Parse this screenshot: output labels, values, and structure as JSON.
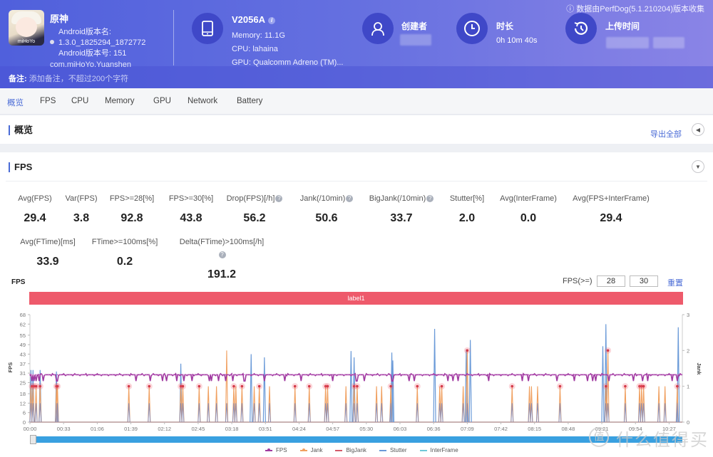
{
  "header": {
    "app": {
      "name": "原神",
      "icon_label": "miHoYo",
      "version_name_label": "Android版本名:",
      "version_name": "1.3.0_1825294_1872772",
      "version_code_line": "Android版本号: 151",
      "package": "com.miHoYo.Yuanshen"
    },
    "device": {
      "icon": "phone-icon",
      "model": "V2056A",
      "memory": "Memory: 11.1G",
      "cpu": "CPU: lahaina",
      "gpu": "GPU: Qualcomm Adreno (TM)..."
    },
    "creator": {
      "icon": "user-icon",
      "title": "创建者"
    },
    "duration": {
      "icon": "clock-icon",
      "title": "时长",
      "value": "0h 10m 40s"
    },
    "upload": {
      "icon": "history-icon",
      "title": "上传时间"
    },
    "perfdog_note": "数据由PerfDog(5.1.210204)版本收集",
    "remark_label": "备注:",
    "remark_placeholder": "添加备注，不超过200个字符"
  },
  "tabs": [
    {
      "label": "概览",
      "active": true
    },
    {
      "label": "FPS"
    },
    {
      "label": "CPU"
    },
    {
      "label": "Memory"
    },
    {
      "label": "GPU"
    },
    {
      "label": "Network"
    },
    {
      "label": "Battery"
    }
  ],
  "overview": {
    "title": "概览",
    "export_label": "导出全部"
  },
  "fps_section": {
    "title": "FPS",
    "metrics_row1": [
      {
        "label": "Avg(FPS)",
        "value": "29.4"
      },
      {
        "label": "Var(FPS)",
        "value": "3.8"
      },
      {
        "label": "FPS>=28[%]",
        "value": "92.8"
      },
      {
        "label": "FPS>=30[%]",
        "value": "43.8"
      },
      {
        "label": "Drop(FPS)[/h]",
        "value": "56.2",
        "help": true
      },
      {
        "label": "Jank(/10min)",
        "value": "50.6",
        "help": true
      },
      {
        "label": "BigJank(/10min)",
        "value": "33.7",
        "help": true
      },
      {
        "label": "Stutter[%]",
        "value": "2.0"
      },
      {
        "label": "Avg(InterFrame)",
        "value": "0.0"
      },
      {
        "label": "Avg(FPS+InterFrame)",
        "value": "29.4"
      }
    ],
    "metrics_row2": [
      {
        "label": "Avg(FTime)[ms]",
        "value": "33.9"
      },
      {
        "label": "FTime>=100ms[%]",
        "value": "0.2"
      },
      {
        "label": "Delta(FTime)>100ms[/h]",
        "value": "191.2",
        "help": true
      }
    ],
    "chart_title": "FPS",
    "threshold_label": "FPS(>=)",
    "threshold_low": "28",
    "threshold_high": "30",
    "reset_label": "重置",
    "label_bar": "label1"
  },
  "chart_data": {
    "type": "line",
    "title": "FPS",
    "xlabel": "",
    "ylabel": "FPS",
    "y2label": "Jank",
    "ylim": [
      0,
      68
    ],
    "y2lim": [
      0,
      3
    ],
    "yticks": [
      0,
      6,
      12,
      18,
      25,
      31,
      37,
      43,
      49,
      55,
      62,
      68
    ],
    "y2ticks": [
      0,
      1,
      2,
      3
    ],
    "x_ticks": [
      "00:00",
      "00:33",
      "01:06",
      "01:39",
      "02:12",
      "02:45",
      "03:18",
      "03:51",
      "04:24",
      "04:57",
      "05:30",
      "06:03",
      "06:36",
      "07:09",
      "07:42",
      "08:15",
      "08:48",
      "09:21",
      "09:54",
      "10:27"
    ],
    "duration_s": 640,
    "fps_baseline": 30,
    "legend": [
      {
        "name": "FPS",
        "color": "#a03aa0",
        "marker": true
      },
      {
        "name": "Jank",
        "color": "#f0a060",
        "marker": true
      },
      {
        "name": "BigJank",
        "color": "#d45a6a",
        "marker": false
      },
      {
        "name": "Stutter",
        "color": "#6a9ad8",
        "marker": false
      },
      {
        "name": "InterFrame",
        "color": "#70c8d8",
        "marker": false
      }
    ],
    "fps_dips_s": [
      2,
      4,
      6,
      9,
      13,
      26,
      27,
      104,
      118,
      130,
      134,
      144,
      151,
      159,
      176,
      178,
      185,
      192,
      199,
      210,
      211,
      230,
      250,
      250,
      266,
      297,
      320,
      321,
      328,
      355,
      356,
      372,
      377,
      410,
      415,
      420,
      450,
      483,
      489,
      517,
      534,
      547,
      552,
      555,
      568,
      592,
      601,
      606,
      630,
      635
    ],
    "jank_events": [
      {
        "t": 1,
        "v": 1
      },
      {
        "t": 3,
        "v": 1
      },
      {
        "t": 6,
        "v": 1
      },
      {
        "t": 10,
        "v": 1
      },
      {
        "t": 26,
        "v": 1
      },
      {
        "t": 27,
        "v": 1
      },
      {
        "t": 97,
        "v": 1
      },
      {
        "t": 117,
        "v": 1
      },
      {
        "t": 148,
        "v": 1
      },
      {
        "t": 150,
        "v": 1
      },
      {
        "t": 166,
        "v": 1
      },
      {
        "t": 175,
        "v": 1
      },
      {
        "t": 183,
        "v": 1
      },
      {
        "t": 193,
        "v": 2
      },
      {
        "t": 200,
        "v": 1
      },
      {
        "t": 202,
        "v": 1
      },
      {
        "t": 208,
        "v": 1
      },
      {
        "t": 220,
        "v": 1
      },
      {
        "t": 225,
        "v": 1
      },
      {
        "t": 235,
        "v": 1
      },
      {
        "t": 260,
        "v": 1
      },
      {
        "t": 274,
        "v": 1
      },
      {
        "t": 290,
        "v": 1
      },
      {
        "t": 292,
        "v": 1
      },
      {
        "t": 310,
        "v": 1
      },
      {
        "t": 318,
        "v": 1
      },
      {
        "t": 321,
        "v": 1
      },
      {
        "t": 340,
        "v": 1
      },
      {
        "t": 345,
        "v": 1
      },
      {
        "t": 354,
        "v": 1
      },
      {
        "t": 380,
        "v": 1
      },
      {
        "t": 402,
        "v": 1
      },
      {
        "t": 404,
        "v": 1
      },
      {
        "t": 425,
        "v": 1
      },
      {
        "t": 429,
        "v": 2
      },
      {
        "t": 473,
        "v": 1
      },
      {
        "t": 490,
        "v": 1
      },
      {
        "t": 492,
        "v": 1
      },
      {
        "t": 498,
        "v": 1
      },
      {
        "t": 520,
        "v": 1
      },
      {
        "t": 565,
        "v": 1
      },
      {
        "t": 567,
        "v": 2
      },
      {
        "t": 584,
        "v": 1
      },
      {
        "t": 598,
        "v": 1
      },
      {
        "t": 600,
        "v": 1
      },
      {
        "t": 602,
        "v": 1
      },
      {
        "t": 617,
        "v": 1
      },
      {
        "t": 623,
        "v": 1
      },
      {
        "t": 635,
        "v": 1
      }
    ],
    "bigjank_s": [
      2,
      4,
      6,
      10,
      26,
      27,
      97,
      117,
      148,
      150,
      166,
      200,
      208,
      225,
      260,
      274,
      290,
      292,
      318,
      321,
      354,
      380,
      404,
      429,
      473,
      520,
      565,
      567,
      584,
      598,
      600,
      602,
      635
    ],
    "stutter_peaks": [
      {
        "t": 1,
        "v": 33
      },
      {
        "t": 3,
        "v": 33
      },
      {
        "t": 10,
        "v": 33
      },
      {
        "t": 26,
        "v": 32
      },
      {
        "t": 148,
        "v": 37
      },
      {
        "t": 217,
        "v": 43
      },
      {
        "t": 230,
        "v": 41
      },
      {
        "t": 315,
        "v": 45
      },
      {
        "t": 318,
        "v": 41
      },
      {
        "t": 355,
        "v": 44
      },
      {
        "t": 356,
        "v": 39
      },
      {
        "t": 397,
        "v": 59
      },
      {
        "t": 428,
        "v": 46
      },
      {
        "t": 432,
        "v": 52
      },
      {
        "t": 562,
        "v": 48
      },
      {
        "t": 565,
        "v": 62
      },
      {
        "t": 636,
        "v": 60
      }
    ]
  },
  "watermark": "什么值得买",
  "watermark_badge": "值"
}
